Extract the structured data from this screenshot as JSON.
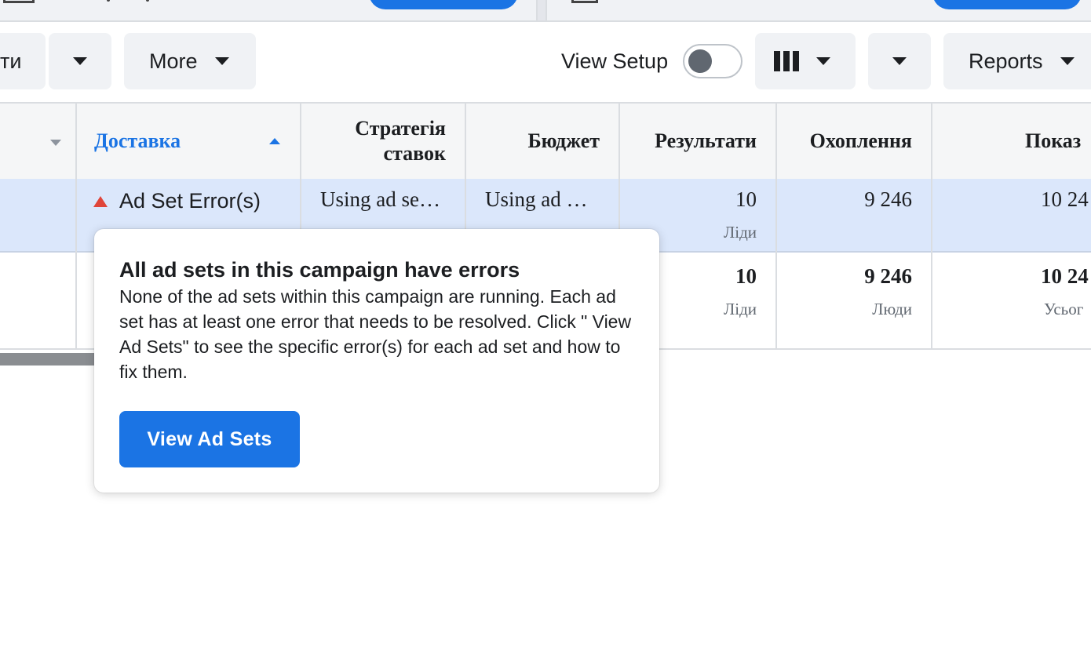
{
  "toolbar": {
    "truncated_left_label": "ти",
    "more_label": "More",
    "view_setup_label": "View Setup",
    "reports_label": "Reports",
    "view_setup_enabled": false
  },
  "table": {
    "headers": {
      "delivery": "Доставка",
      "bid_strategy_line1": "Стратегія",
      "bid_strategy_line2": "ставок",
      "budget": "Бюджет",
      "results": "Результати",
      "reach": "Охоплення",
      "impressions": "Показ"
    },
    "row1": {
      "delivery": "Ad Set Error(s)",
      "bid_strategy": "Using ad se…",
      "budget": "Using ad …",
      "results": "10",
      "results_sub": "Ліди",
      "reach": "9 246",
      "impressions": "10 24"
    },
    "row2": {
      "results": "10",
      "results_sub": "Ліди",
      "reach": "9 246",
      "reach_sub": "Люди",
      "impressions": "10 24",
      "impressions_sub": "Усьог"
    }
  },
  "popover": {
    "title": "All ad sets in this campaign have errors",
    "body": "None of the ad sets within this campaign are running. Each ad set has at least one error that needs to be resolved. Click \" View Ad Sets\" to see the specific error(s) for each ad set and how to fix them.",
    "button_label": "View Ad Sets"
  },
  "colors": {
    "accent": "#1b74e4",
    "error": "#e0453a",
    "selected_row": "#dbe7fb",
    "sort_header": "#1b74e4"
  }
}
